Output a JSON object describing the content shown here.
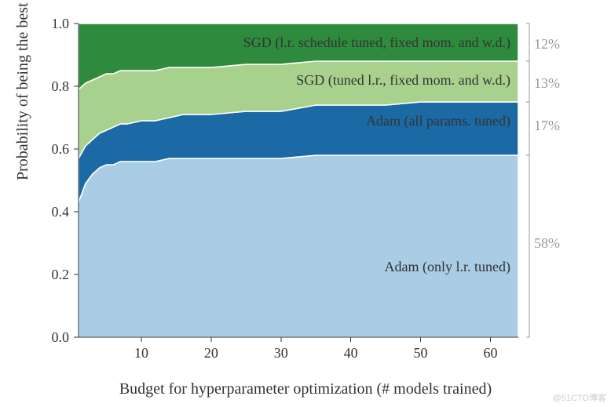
{
  "chart_data": {
    "type": "area",
    "stacked": true,
    "xlabel": "Budget for hyperparameter optimization (# models trained)",
    "ylabel": "Probability of being the best",
    "x_ticks": [
      10,
      20,
      30,
      40,
      50,
      60
    ],
    "y_ticks": [
      0.0,
      0.2,
      0.4,
      0.6,
      0.8,
      1.0
    ],
    "ylim": [
      0.0,
      1.0
    ],
    "xlim": [
      1,
      64
    ],
    "x": [
      1,
      2,
      3,
      4,
      5,
      6,
      7,
      8,
      10,
      12,
      14,
      16,
      18,
      20,
      25,
      30,
      35,
      40,
      45,
      50,
      55,
      60,
      64
    ],
    "series": [
      {
        "name": "Adam (only l.r. tuned)",
        "color": "#a9cde5",
        "final_pct": "58%",
        "values": [
          0.43,
          0.49,
          0.52,
          0.54,
          0.55,
          0.55,
          0.56,
          0.56,
          0.56,
          0.56,
          0.57,
          0.57,
          0.57,
          0.57,
          0.57,
          0.57,
          0.58,
          0.58,
          0.58,
          0.58,
          0.58,
          0.58,
          0.58
        ]
      },
      {
        "name": "Adam (all params. tuned)",
        "color": "#1b6aa5",
        "final_pct": "17%",
        "values": [
          0.14,
          0.12,
          0.11,
          0.11,
          0.11,
          0.12,
          0.12,
          0.12,
          0.13,
          0.13,
          0.13,
          0.14,
          0.14,
          0.14,
          0.15,
          0.15,
          0.16,
          0.16,
          0.16,
          0.17,
          0.17,
          0.17,
          0.17
        ]
      },
      {
        "name": "SGD (tuned l.r., fixed mom. and w.d.)",
        "color": "#a9d18e",
        "final_pct": "13%",
        "values": [
          0.22,
          0.2,
          0.19,
          0.18,
          0.18,
          0.17,
          0.17,
          0.17,
          0.16,
          0.16,
          0.16,
          0.15,
          0.15,
          0.15,
          0.15,
          0.15,
          0.14,
          0.14,
          0.14,
          0.13,
          0.13,
          0.13,
          0.13
        ]
      },
      {
        "name": "SGD (l.r. schedule tuned, fixed mom. and w.d.)",
        "color": "#2e8b3d",
        "final_pct": "12%",
        "values": [
          0.21,
          0.19,
          0.18,
          0.17,
          0.16,
          0.16,
          0.15,
          0.15,
          0.15,
          0.15,
          0.14,
          0.14,
          0.14,
          0.14,
          0.13,
          0.13,
          0.12,
          0.12,
          0.12,
          0.12,
          0.12,
          0.12,
          0.12
        ]
      }
    ],
    "watermark": "@51CTO博客"
  }
}
